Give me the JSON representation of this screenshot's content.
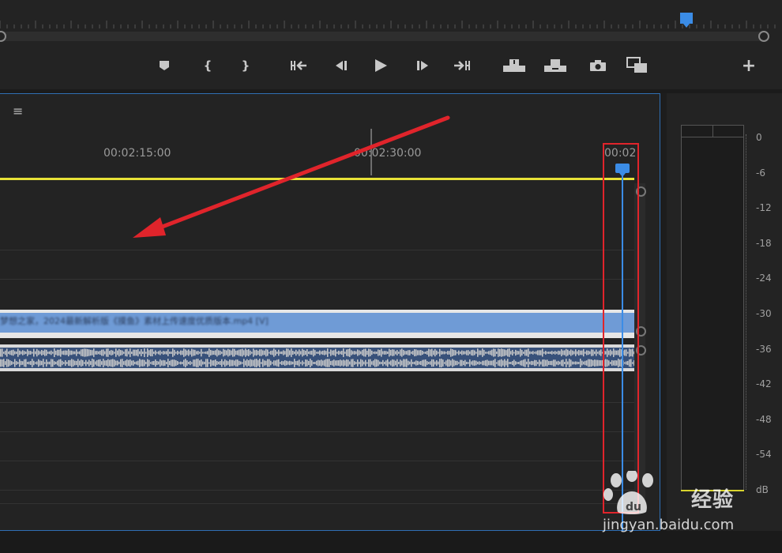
{
  "program_monitor": {
    "controls": [
      {
        "name": "add-marker-button",
        "icon": "marker-icon"
      },
      {
        "name": "mark-in-button",
        "icon": "mark-in-icon",
        "label": "{"
      },
      {
        "name": "mark-out-button",
        "icon": "mark-out-icon",
        "label": "}"
      },
      {
        "name": "go-to-in-button",
        "icon": "go-to-in-icon"
      },
      {
        "name": "step-back-button",
        "icon": "step-back-icon"
      },
      {
        "name": "play-button",
        "icon": "play-icon"
      },
      {
        "name": "step-forward-button",
        "icon": "step-forward-icon"
      },
      {
        "name": "go-to-out-button",
        "icon": "go-to-out-icon"
      },
      {
        "name": "lift-button",
        "icon": "lift-icon"
      },
      {
        "name": "extract-button",
        "icon": "extract-icon"
      },
      {
        "name": "export-frame-button",
        "icon": "camera-icon"
      },
      {
        "name": "comparison-view-button",
        "icon": "compare-icon"
      },
      {
        "name": "button-editor",
        "icon": "plus-icon",
        "label": "+"
      }
    ]
  },
  "timeline": {
    "menu_glyph": "≡",
    "timecodes": [
      "00:02:15:00",
      "00:02:30:00",
      "00:02"
    ],
    "video_clip_name": "梦想之家，2024最新解析版《摸鱼》素材上传速度优质版本.mp4 [V]",
    "colors": {
      "work_area": "#e7e237",
      "playhead": "#3b8ce6",
      "video_clip": "#6f9bd6",
      "audio_clip": "#38517a",
      "highlight": "#e0242b"
    }
  },
  "audio_meter": {
    "scale": [
      "0",
      "-6",
      "-12",
      "-18",
      "-24",
      "-30",
      "-36",
      "-42",
      "-48",
      "-54",
      "dB"
    ]
  },
  "watermark": {
    "brand": "经验",
    "url": "jingyan.baidu.com"
  }
}
